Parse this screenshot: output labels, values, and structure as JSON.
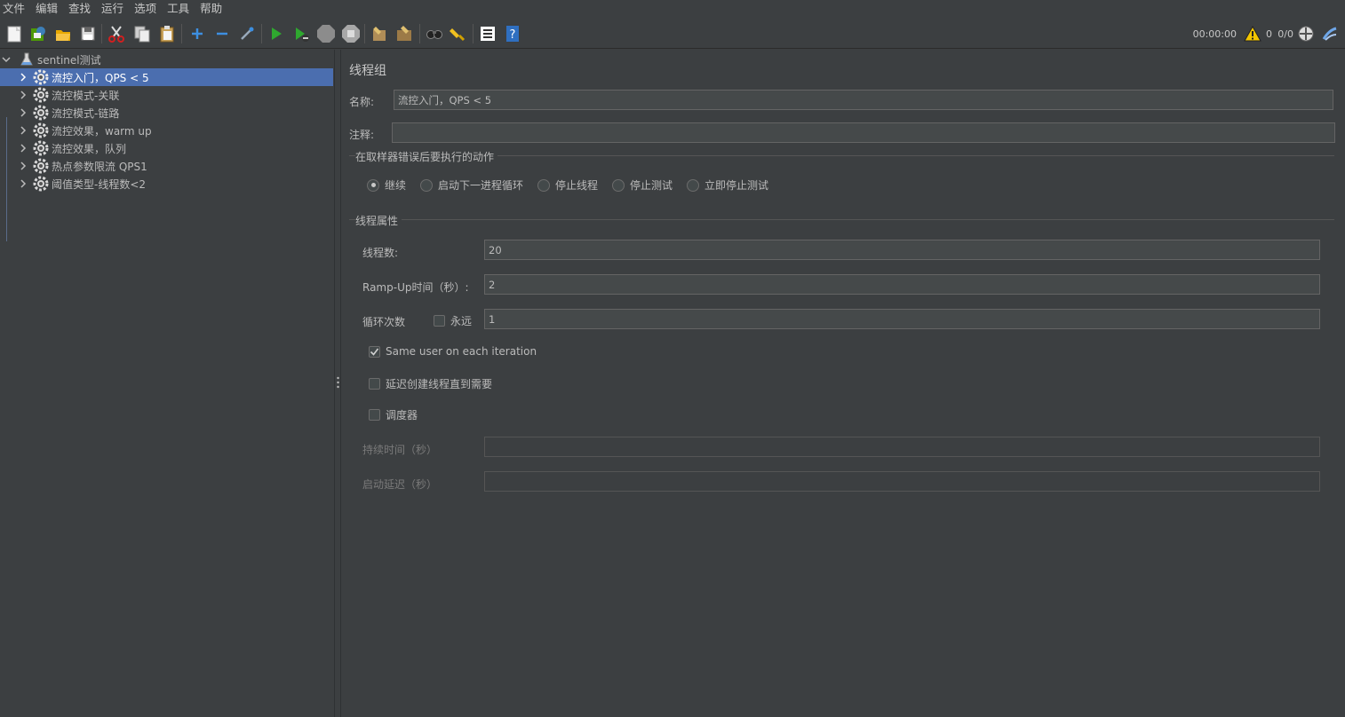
{
  "menu": [
    "文件",
    "编辑",
    "查找",
    "运行",
    "选项",
    "工具",
    "帮助"
  ],
  "status": {
    "elapsed": "00:00:00",
    "warnings": "0",
    "threads": "0/0"
  },
  "tree": {
    "root": "sentinel测试",
    "items": [
      {
        "label": "流控入门，QPS < 5",
        "selected": true
      },
      {
        "label": "流控模式-关联"
      },
      {
        "label": "流控模式-链路"
      },
      {
        "label": "流控效果，warm up"
      },
      {
        "label": "流控效果，队列"
      },
      {
        "label": "热点参数限流 QPS1"
      },
      {
        "label": "阈值类型-线程数<2"
      }
    ]
  },
  "panel": {
    "title": "线程组",
    "name_label": "名称:",
    "name_value": "流控入门，QPS < 5",
    "comment_label": "注释:",
    "comment_value": "",
    "error_group_title": "在取样器错误后要执行的动作",
    "error_actions": [
      "继续",
      "启动下一进程循环",
      "停止线程",
      "停止测试",
      "立即停止测试"
    ],
    "error_action_selected": 0,
    "thread_props_title": "线程属性",
    "threads_label": "线程数:",
    "threads_value": "20",
    "rampup_label": "Ramp-Up时间（秒）:",
    "rampup_value": "2",
    "loop_label": "循环次数",
    "forever_label": "永远",
    "forever_checked": false,
    "loop_value": "1",
    "same_user_label": "Same user on each iteration",
    "same_user_checked": true,
    "delay_create_label": "延迟创建线程直到需要",
    "delay_create_checked": false,
    "scheduler_label": "调度器",
    "scheduler_checked": false,
    "duration_label": "持续时间（秒）",
    "duration_value": "",
    "startup_delay_label": "启动延迟（秒）",
    "startup_delay_value": ""
  },
  "colors": {
    "background": "#3c3f41",
    "selection": "#4b6eaf",
    "field": "#45494a"
  }
}
